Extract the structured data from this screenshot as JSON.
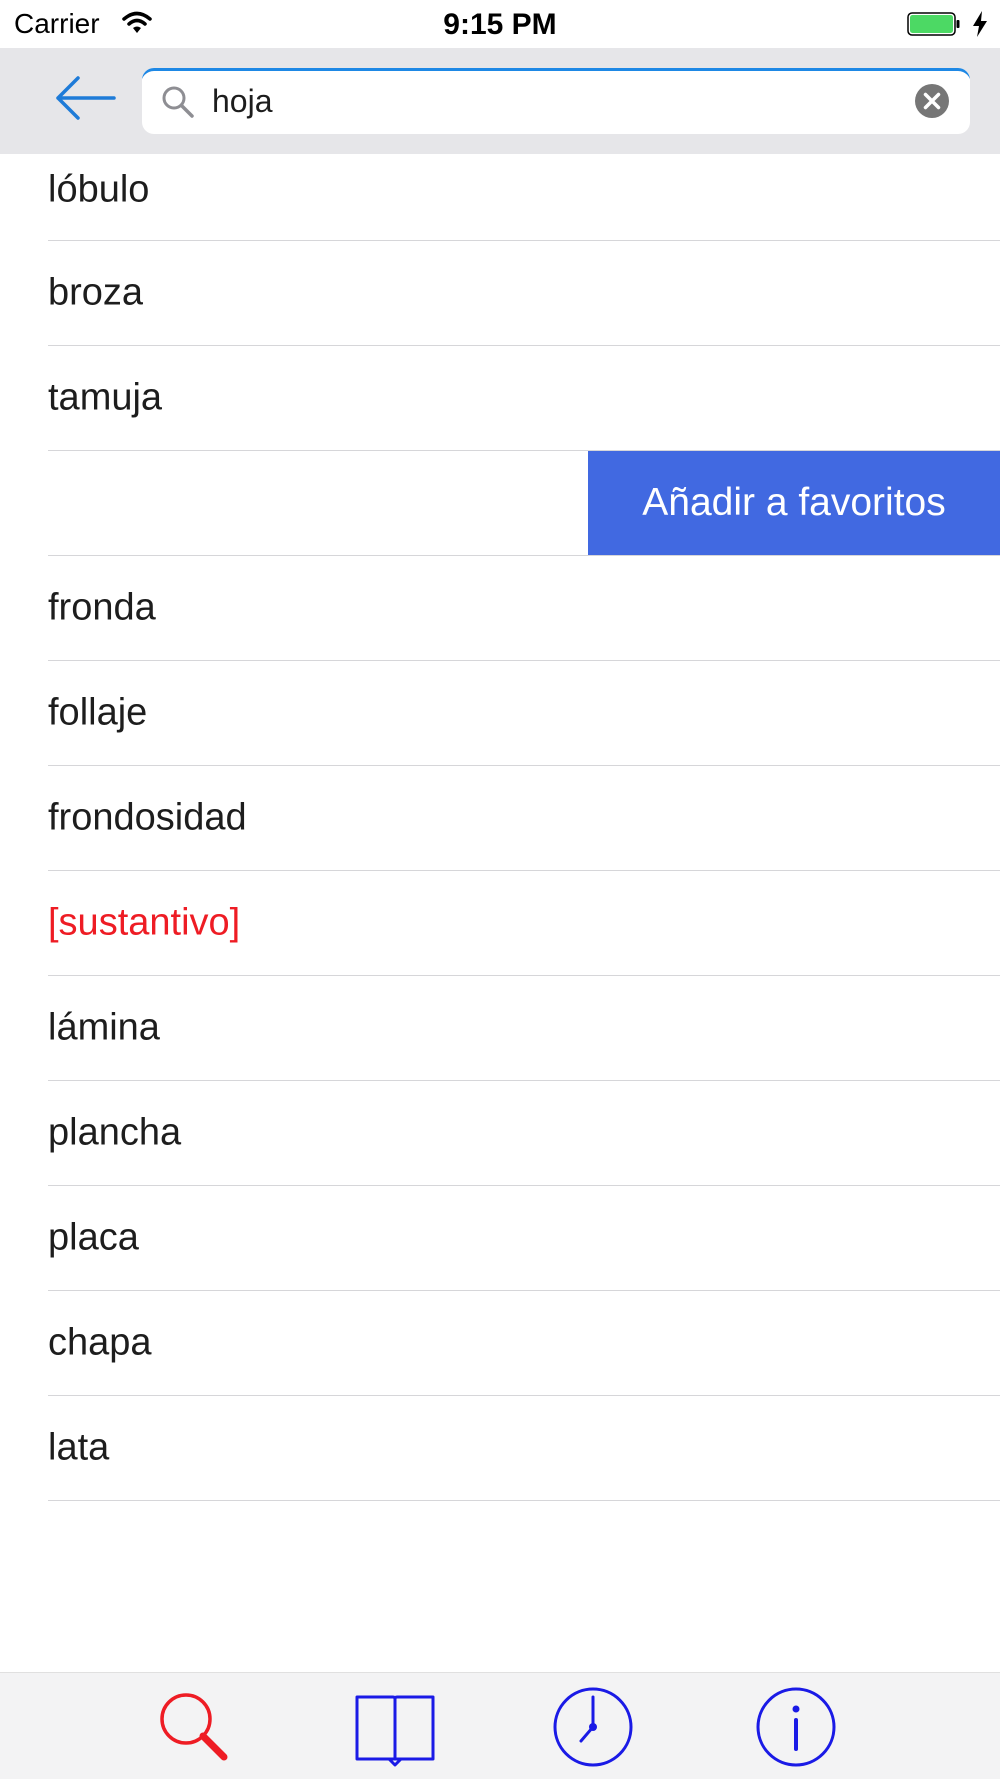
{
  "status_bar": {
    "carrier": "Carrier",
    "time": "9:15 PM",
    "battery_color": "#4cd964"
  },
  "search": {
    "value": "hoja",
    "accent_color": "#1e88e5",
    "back_icon": "arrow-left-icon",
    "search_icon": "magnifier-icon",
    "clear_icon": "clear-circle-icon"
  },
  "results": [
    {
      "text": "lóbulo",
      "type": "word"
    },
    {
      "text": "broza",
      "type": "word"
    },
    {
      "text": "tamuja",
      "type": "word"
    },
    {
      "text": "",
      "type": "swiped",
      "action_label": "Añadir a favoritos"
    },
    {
      "text": "fronda",
      "type": "word"
    },
    {
      "text": "follaje",
      "type": "word"
    },
    {
      "text": "frondosidad",
      "type": "word"
    },
    {
      "text": "[sustantivo]",
      "type": "category"
    },
    {
      "text": "lámina",
      "type": "word"
    },
    {
      "text": "plancha",
      "type": "word"
    },
    {
      "text": "placa",
      "type": "word"
    },
    {
      "text": "chapa",
      "type": "word"
    },
    {
      "text": "lata",
      "type": "word"
    }
  ],
  "colors": {
    "category_text": "#ee1c24",
    "action_background": "#4169e1",
    "tab_active": "#ee1c24",
    "tab_inactive": "#1a1ae6"
  },
  "tab_bar": {
    "tabs": [
      {
        "icon": "search-icon",
        "active": true
      },
      {
        "icon": "book-icon",
        "active": false
      },
      {
        "icon": "clock-icon",
        "active": false
      },
      {
        "icon": "info-icon",
        "active": false
      }
    ]
  }
}
